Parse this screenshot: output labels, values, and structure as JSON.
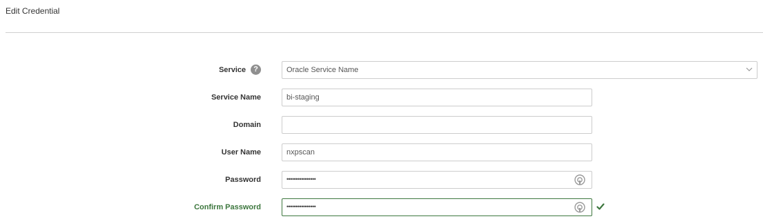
{
  "header": {
    "title": "Edit Credential"
  },
  "form": {
    "service": {
      "label": "Service",
      "value": "Oracle Service Name",
      "help_icon": "?"
    },
    "service_name": {
      "label": "Service Name",
      "value": "bi-staging"
    },
    "domain": {
      "label": "Domain",
      "value": ""
    },
    "user_name": {
      "label": "User Name",
      "value": "nxpscan"
    },
    "password": {
      "label": "Password",
      "masked": "••••••••••••••••"
    },
    "confirm_password": {
      "label": "Confirm Password",
      "masked": "••••••••••••••••",
      "status": "valid"
    }
  },
  "colors": {
    "success": "#3c763d",
    "border": "#cccccc",
    "divider": "#cfcfcf",
    "help_icon_bg": "#8f8f8f"
  },
  "icons": {
    "help": "help-icon",
    "chevron": "chevron-down-icon",
    "reveal": "reveal-password-icon",
    "check": "check-icon"
  }
}
